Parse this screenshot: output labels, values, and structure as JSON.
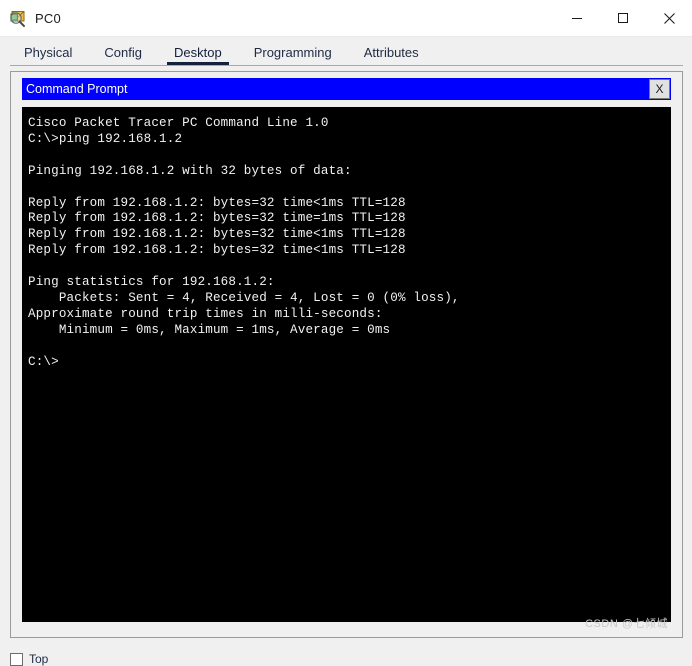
{
  "window": {
    "title": "PC0",
    "icon": "packet-tracer-pc-icon",
    "controls": {
      "minimize": "—",
      "maximize": "□",
      "close": "✕"
    }
  },
  "tabs": [
    {
      "label": "Physical",
      "active": false
    },
    {
      "label": "Config",
      "active": false
    },
    {
      "label": "Desktop",
      "active": true
    },
    {
      "label": "Programming",
      "active": false
    },
    {
      "label": "Attributes",
      "active": false
    }
  ],
  "command_prompt": {
    "title": "Command Prompt",
    "close_label": "X",
    "terminal_text": "Cisco Packet Tracer PC Command Line 1.0\nC:\\>ping 192.168.1.2\n\nPinging 192.168.1.2 with 32 bytes of data:\n\nReply from 192.168.1.2: bytes=32 time<1ms TTL=128\nReply from 192.168.1.2: bytes=32 time=1ms TTL=128\nReply from 192.168.1.2: bytes=32 time<1ms TTL=128\nReply from 192.168.1.2: bytes=32 time<1ms TTL=128\n\nPing statistics for 192.168.1.2:\n    Packets: Sent = 4, Received = 4, Lost = 0 (0% loss),\nApproximate round trip times in milli-seconds:\n    Minimum = 0ms, Maximum = 1ms, Average = 0ms\n\nC:\\>",
    "lines": [
      "Cisco Packet Tracer PC Command Line 1.0",
      "C:\\>ping 192.168.1.2",
      "",
      "Pinging 192.168.1.2 with 32 bytes of data:",
      "",
      "Reply from 192.168.1.2: bytes=32 time<1ms TTL=128",
      "Reply from 192.168.1.2: bytes=32 time=1ms TTL=128",
      "Reply from 192.168.1.2: bytes=32 time<1ms TTL=128",
      "Reply from 192.168.1.2: bytes=32 time<1ms TTL=128",
      "",
      "Ping statistics for 192.168.1.2:",
      "    Packets: Sent = 4, Received = 4, Lost = 0 (0% loss),",
      "Approximate round trip times in milli-seconds:",
      "    Minimum = 0ms, Maximum = 1ms, Average = 0ms",
      "",
      "C:\\>"
    ]
  },
  "footer": {
    "top_checkbox_label": "Top",
    "top_checkbox_checked": false
  },
  "watermark": {
    "text": "CSDN @七倾城"
  },
  "colors": {
    "header_blue": "#0000ff",
    "terminal_bg": "#000000",
    "terminal_fg": "#f2f2f2",
    "tab_active_underline": "#16213d",
    "window_bg": "#f0f0f0"
  }
}
